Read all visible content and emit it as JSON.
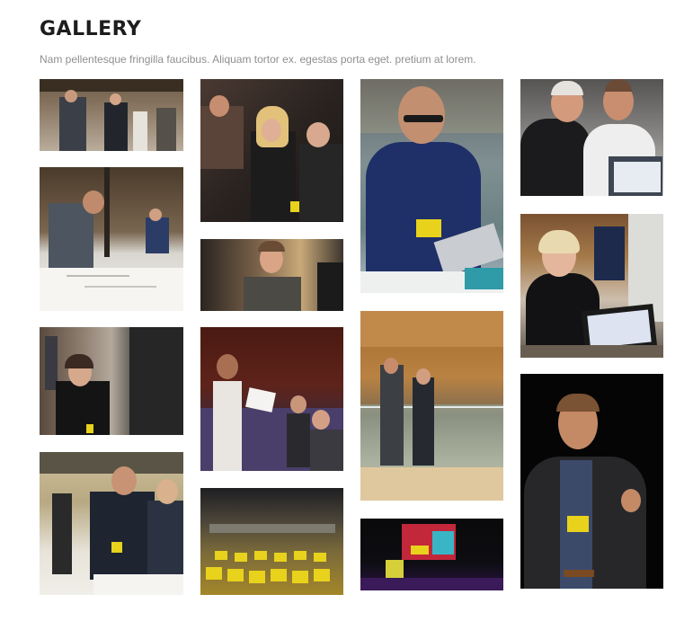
{
  "gallery": {
    "title": "GALLERY",
    "subtitle": "Nam pellentesque fringilla faucibus. Aliquam tortor ex. egestas porta eget. pretium at lorem."
  },
  "photos": [
    {
      "id": "p1",
      "icon": "photo"
    },
    {
      "id": "p2",
      "icon": "photo"
    },
    {
      "id": "p3",
      "icon": "photo"
    },
    {
      "id": "p4",
      "icon": "photo"
    },
    {
      "id": "p5",
      "icon": "photo"
    },
    {
      "id": "p6",
      "icon": "photo"
    },
    {
      "id": "p7",
      "icon": "photo"
    },
    {
      "id": "p8",
      "icon": "photo"
    },
    {
      "id": "p9",
      "icon": "photo"
    },
    {
      "id": "p10",
      "icon": "photo"
    },
    {
      "id": "p11",
      "icon": "photo"
    },
    {
      "id": "p12",
      "icon": "photo"
    },
    {
      "id": "p13",
      "icon": "photo"
    },
    {
      "id": "p14",
      "icon": "photo"
    },
    {
      "id": "p15",
      "icon": "photo"
    }
  ],
  "colors": {
    "title": "#1d1d1d",
    "subtitle": "#8f8f8f",
    "badge": "#e8d21c"
  }
}
